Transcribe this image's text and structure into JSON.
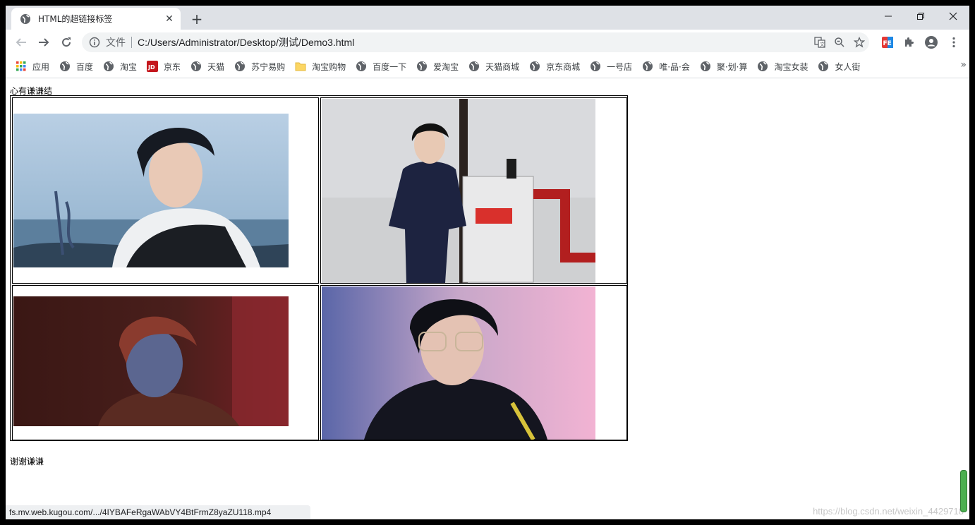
{
  "tab": {
    "title": "HTML的超链接标签",
    "close": "✕",
    "new_tab": "+"
  },
  "window_controls": {
    "minimize": "—",
    "restore": "❐",
    "close": "✕"
  },
  "omnibox": {
    "scheme_label": "文件",
    "url": "C:/Users/Administrator/Desktop/测试/Demo3.html"
  },
  "extension_badge": "FE",
  "bookmarks": [
    {
      "label": "应用",
      "icon": "apps-grid-icon"
    },
    {
      "label": "百度",
      "icon": "globe-icon"
    },
    {
      "label": "淘宝",
      "icon": "globe-icon"
    },
    {
      "label": "京东",
      "icon": "jd-icon"
    },
    {
      "label": "天猫",
      "icon": "globe-icon"
    },
    {
      "label": "苏宁易购",
      "icon": "globe-icon"
    },
    {
      "label": "淘宝购物",
      "icon": "folder-icon"
    },
    {
      "label": "百度一下",
      "icon": "globe-icon"
    },
    {
      "label": "爱淘宝",
      "icon": "globe-icon"
    },
    {
      "label": "天猫商城",
      "icon": "globe-icon"
    },
    {
      "label": "京东商城",
      "icon": "globe-icon"
    },
    {
      "label": "一号店",
      "icon": "globe-icon"
    },
    {
      "label": "唯·品·会",
      "icon": "globe-icon"
    },
    {
      "label": "聚·划·算",
      "icon": "globe-icon"
    },
    {
      "label": "淘宝女装",
      "icon": "globe-icon"
    },
    {
      "label": "女人街",
      "icon": "globe-icon"
    }
  ],
  "bookmarks_more": "»",
  "page": {
    "heading": "心有谦谦结",
    "footer": "谢谢谦谦",
    "status_url": "fs.mv.web.kugou.com/.../4IYBAFeRgaWAbVY4BtFrmZ8yaZU118.mp4",
    "watermark": "https://blog.csdn.net/weixin_4429718"
  },
  "colors": {
    "chrome_bg": "#dee1e6",
    "omnibox_bg": "#f1f3f4",
    "scroll_thumb": "#4caf50"
  }
}
